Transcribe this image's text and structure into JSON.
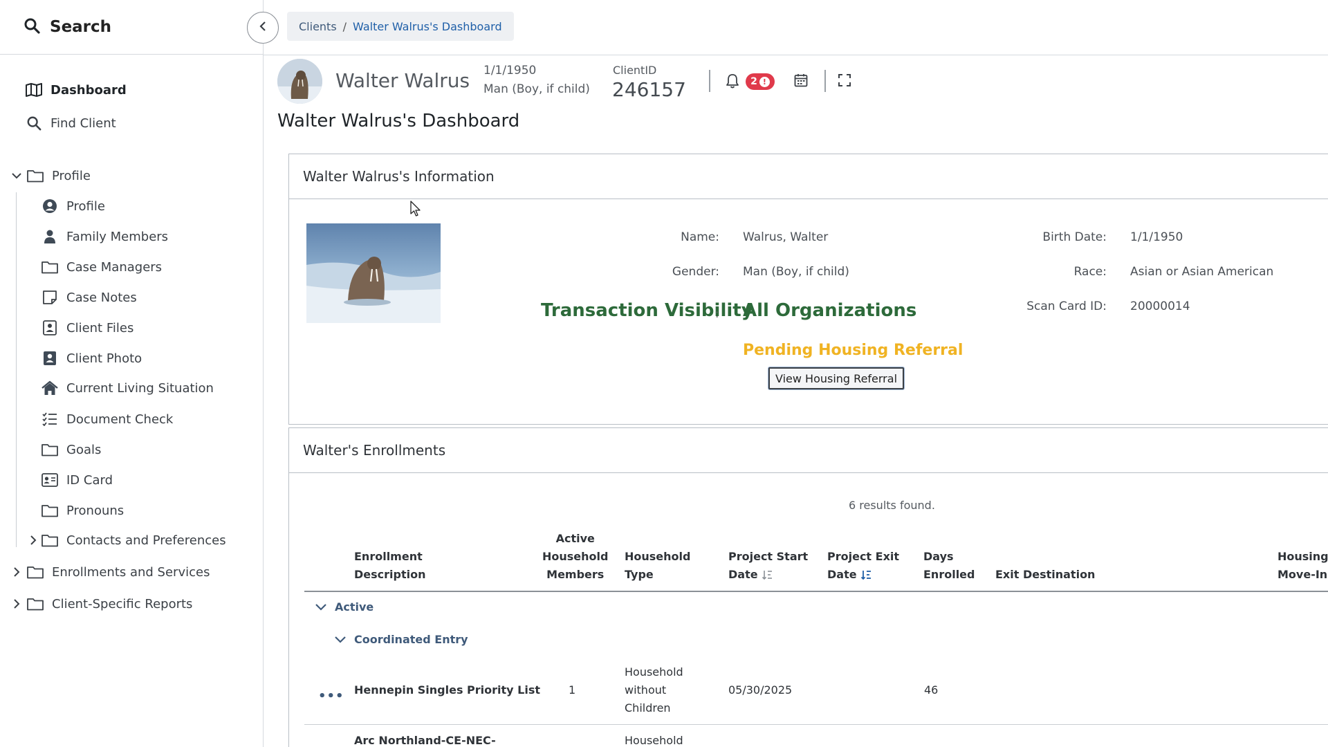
{
  "sidebar": {
    "search_label": "Search",
    "items": [
      {
        "label": "Dashboard"
      },
      {
        "label": "Find Client"
      },
      {
        "label": "Profile"
      },
      {
        "label": "Profile"
      },
      {
        "label": "Family Members"
      },
      {
        "label": "Case Managers"
      },
      {
        "label": "Case Notes"
      },
      {
        "label": "Client Files"
      },
      {
        "label": "Client Photo"
      },
      {
        "label": "Current Living Situation"
      },
      {
        "label": "Document Check"
      },
      {
        "label": "Goals"
      },
      {
        "label": "ID Card"
      },
      {
        "label": "Pronouns"
      },
      {
        "label": "Contacts and Preferences"
      },
      {
        "label": "Enrollments and Services"
      },
      {
        "label": "Client-Specific Reports"
      }
    ]
  },
  "breadcrumb": {
    "crumb1": "Clients",
    "separator": "/",
    "crumb2": "Walter Walrus's Dashboard"
  },
  "client": {
    "name": "Walter Walrus",
    "dob": "1/1/1950",
    "gender": "Man (Boy, if child)",
    "client_id_label": "ClientID",
    "client_id": "246157",
    "notification_count": "2",
    "notification_alert": "!"
  },
  "page_title": "Walter Walrus's Dashboard",
  "info": {
    "header": "Walter Walrus's Information",
    "name_label": "Name:",
    "name_value": "Walrus, Walter",
    "gender_label": "Gender:",
    "gender_value": "Man (Boy, if child)",
    "birth_label": "Birth Date:",
    "birth_value": "1/1/1950",
    "race_label": "Race:",
    "race_value": "Asian or Asian American",
    "scan_label": "Scan Card ID:",
    "scan_value": "20000014",
    "tv_label": "Transaction Visibility",
    "tv_colon": ":",
    "tv_value": "All Organizations",
    "pending": "Pending Housing Referral",
    "view_button": "View Housing Referral"
  },
  "enrollments": {
    "header": "Walter's Enrollments",
    "results": "6 results found.",
    "columns": {
      "desc1": "Enrollment",
      "desc2": "Description",
      "active1": "Active",
      "active2": "Household",
      "active3": "Members",
      "htype1": "Household",
      "htype2": "Type",
      "start1": "Project Start",
      "start2": "Date",
      "exit1": "Project Exit",
      "exit2": "Date",
      "days1": "Days",
      "days2": "Enrolled",
      "dest": "Exit Destination",
      "housing1": "Housing",
      "housing2": "Move-In I"
    },
    "group_active": "Active",
    "group_ce": "Coordinated Entry",
    "row1": {
      "desc": "Hennepin Singles Priority List",
      "members": "1",
      "htype1": "Household",
      "htype2": "without",
      "htype3": "Children",
      "start": "05/30/2025",
      "days": "46"
    },
    "row2": {
      "desc": "Arc Northland-CE-NEC-",
      "htype1": "Household"
    }
  },
  "colors": {
    "accent": "#1f5fa8",
    "green": "#2d6a3a",
    "pending": "#f0b323",
    "badge": "#e03a4b"
  }
}
